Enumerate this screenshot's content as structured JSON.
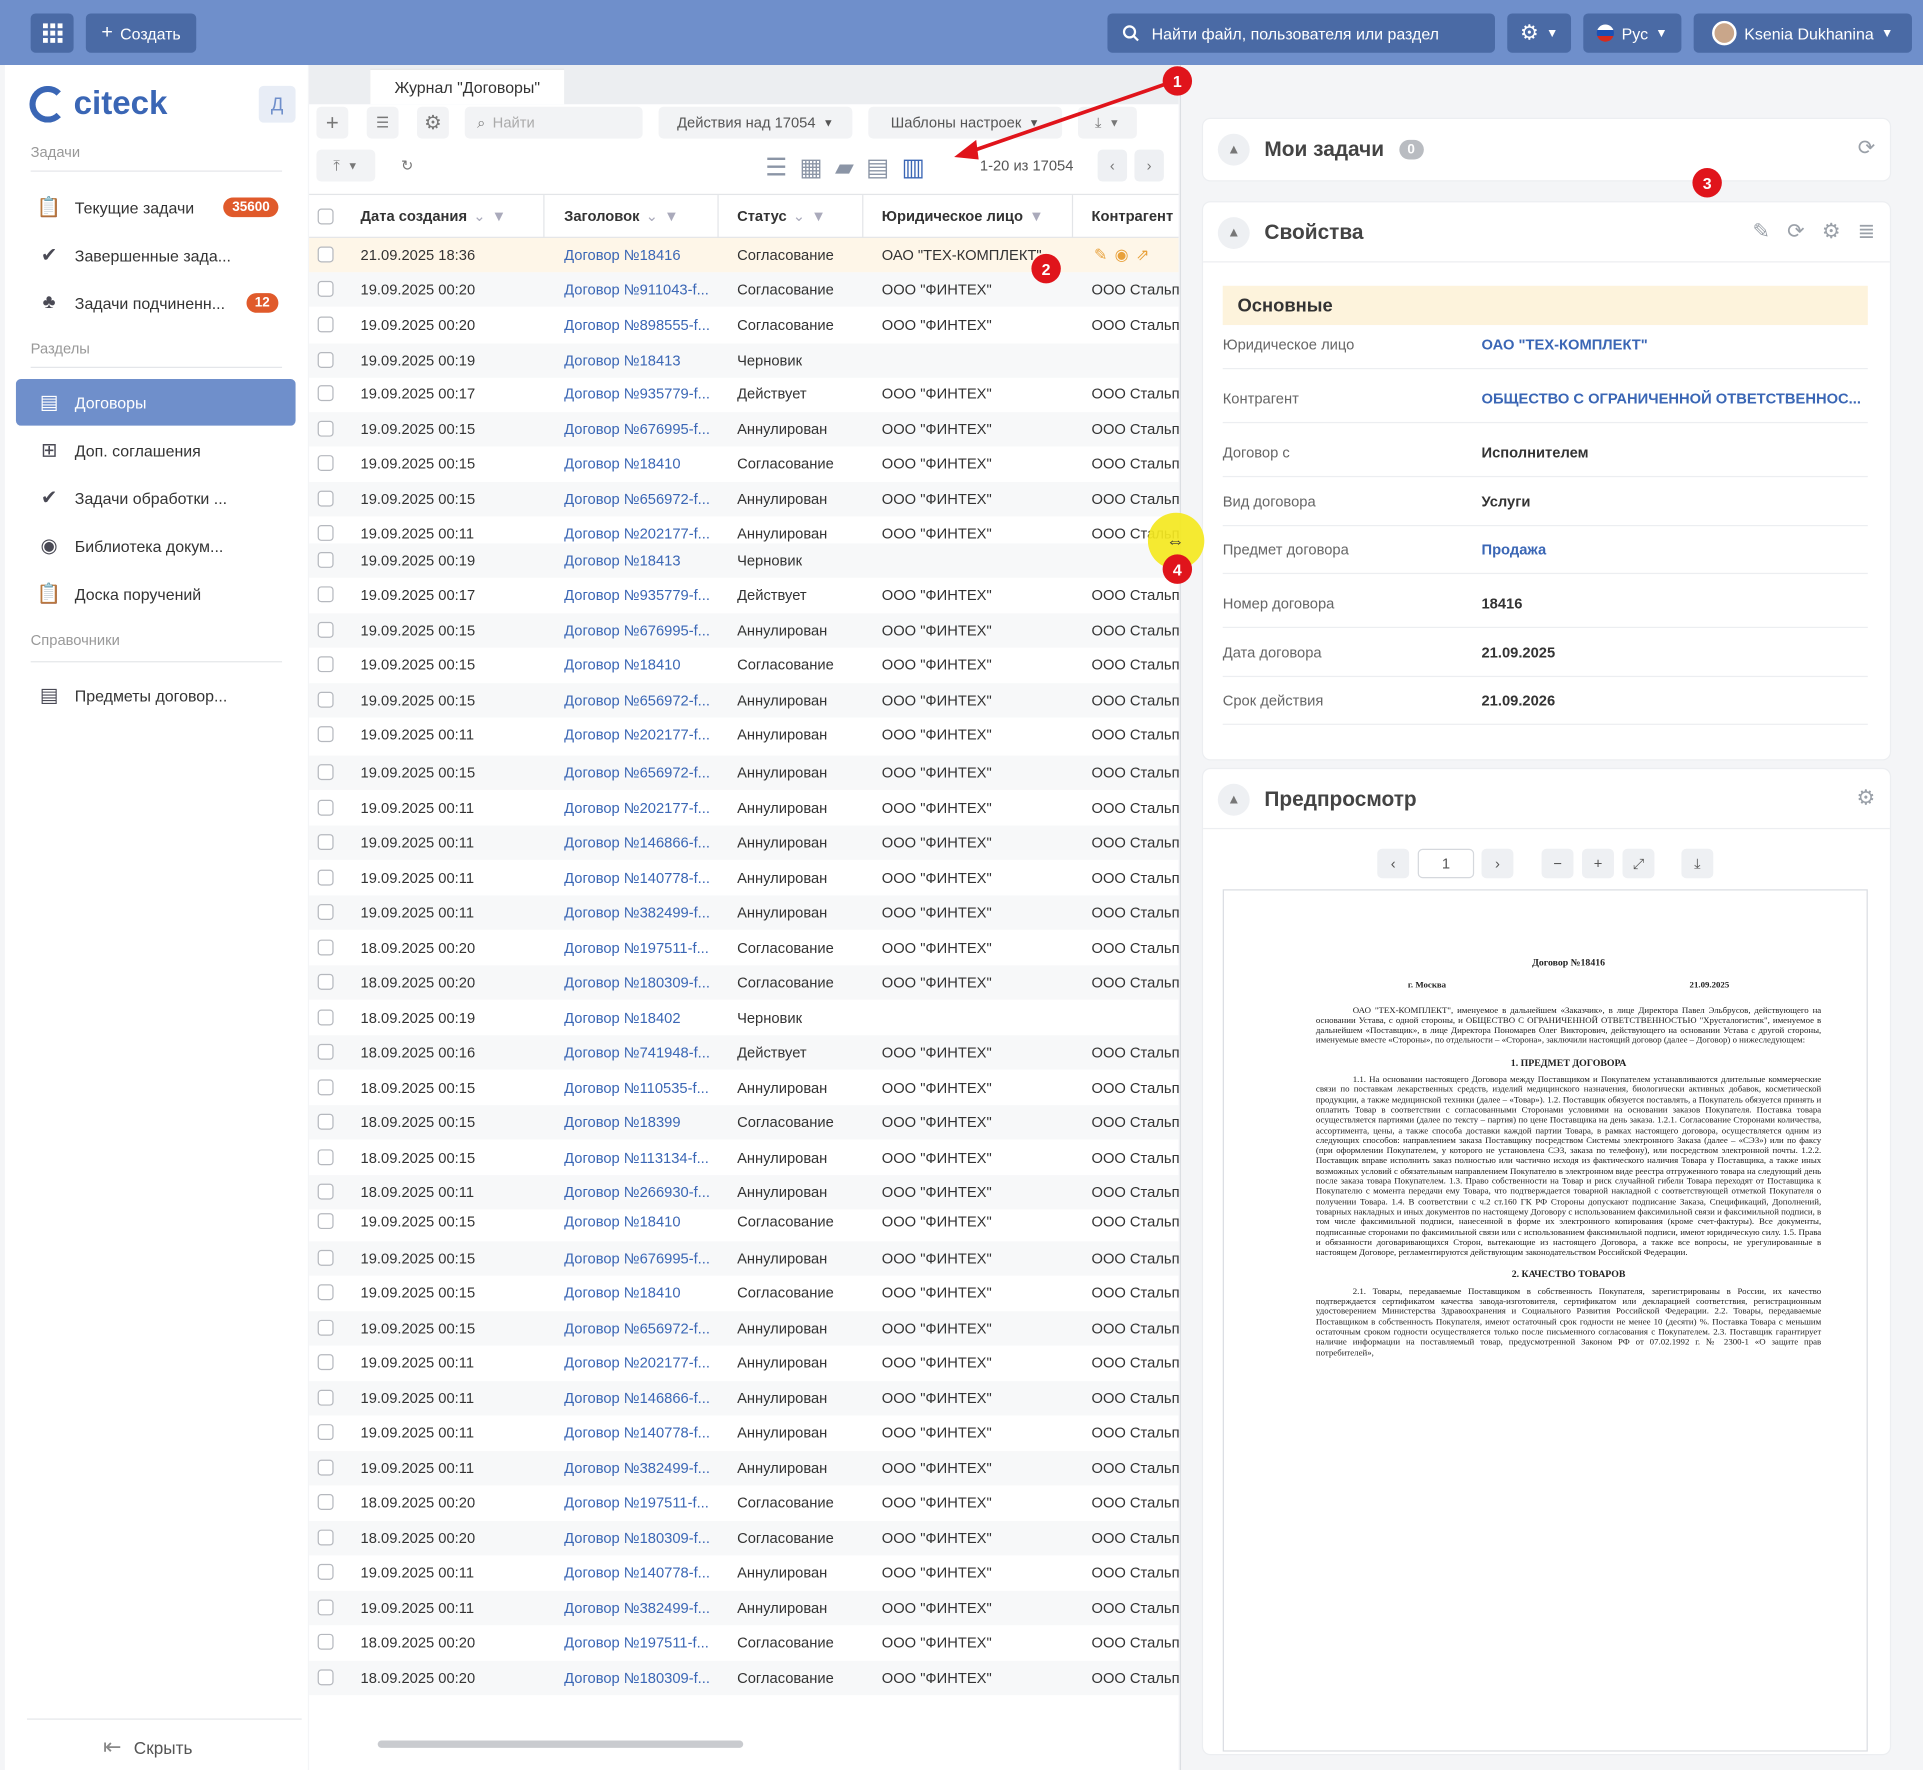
{
  "topbar": {
    "create_label": "Создать",
    "search_placeholder": "Найти файл, пользователя или раздел",
    "lang_label": "Рус",
    "user_name": "Ksenia Dukhanina"
  },
  "sidebar": {
    "logo_text": "citeck",
    "toggle_letter": "Д",
    "section_tasks": "Задачи",
    "section_sections": "Разделы",
    "section_refs": "Справочники",
    "items": [
      {
        "label": "Текущие задачи",
        "badge": "35600"
      },
      {
        "label": "Завершенные зада...",
        "badge": ""
      },
      {
        "label": "Задачи подчиненн...",
        "badge": "12"
      },
      {
        "label": "Договоры",
        "badge": ""
      },
      {
        "label": "Доп. соглашения",
        "badge": ""
      },
      {
        "label": "Задачи обработки ...",
        "badge": ""
      },
      {
        "label": "Библиотека докум...",
        "badge": ""
      },
      {
        "label": "Доска поручений",
        "badge": ""
      },
      {
        "label": "Предметы договор...",
        "badge": ""
      }
    ],
    "hide_label": "Скрыть"
  },
  "journal": {
    "tab_label": "Журнал \"Договоры\"",
    "search_placeholder": "Найти",
    "actions_label": "Действия над 17054",
    "templates_label": "Шаблоны настроек",
    "pagination": "1-20 из 17054",
    "columns": [
      "Дата создания",
      "Заголовок",
      "Статус",
      "Юридическое лицо",
      "Контрагент"
    ],
    "rows": [
      [
        "21.09.2025 18:36",
        "Договор №18416",
        "Согласование",
        "ОАО \"ТЕХ-КОМПЛЕКТ\"",
        ""
      ],
      [
        "19.09.2025 00:20",
        "Договор №911043-f...",
        "Согласование",
        "ООО \"ФИНТЕХ\"",
        "ООО Стальп"
      ],
      [
        "19.09.2025 00:20",
        "Договор №898555-f...",
        "Согласование",
        "ООО \"ФИНТЕХ\"",
        "ООО Стальп"
      ],
      [
        "19.09.2025 00:19",
        "Договор №18413",
        "Черновик",
        "",
        ""
      ],
      [
        "19.09.2025 00:17",
        "Договор №935779-f...",
        "Действует",
        "ООО \"ФИНТЕХ\"",
        "ООО Стальп"
      ],
      [
        "19.09.2025 00:15",
        "Договор №676995-f...",
        "Аннулирован",
        "ООО \"ФИНТЕХ\"",
        "ООО Стальп"
      ],
      [
        "19.09.2025 00:15",
        "Договор №18410",
        "Согласование",
        "ООО \"ФИНТЕХ\"",
        "ООО Стальп"
      ],
      [
        "19.09.2025 00:15",
        "Договор №656972-f...",
        "Аннулирован",
        "ООО \"ФИНТЕХ\"",
        "ООО Стальп"
      ],
      [
        "19.09.2025 00:11",
        "Договор №202177-f...",
        "Аннулирован",
        "ООО \"ФИНТЕХ\"",
        "ООО Стальп"
      ],
      [
        "19.09.2025 00:19",
        "Договор №18413",
        "Черновик",
        "",
        ""
      ],
      [
        "19.09.2025 00:17",
        "Договор №935779-f...",
        "Действует",
        "ООО \"ФИНТЕХ\"",
        "ООО Стальп"
      ],
      [
        "19.09.2025 00:15",
        "Договор №676995-f...",
        "Аннулирован",
        "ООО \"ФИНТЕХ\"",
        "ООО Стальп"
      ],
      [
        "19.09.2025 00:15",
        "Договор №18410",
        "Согласование",
        "ООО \"ФИНТЕХ\"",
        "ООО Стальп"
      ],
      [
        "19.09.2025 00:15",
        "Договор №656972-f...",
        "Аннулирован",
        "ООО \"ФИНТЕХ\"",
        "ООО Стальп"
      ],
      [
        "19.09.2025 00:11",
        "Договор №202177-f...",
        "Аннулирован",
        "ООО \"ФИНТЕХ\"",
        "ООО Стальп"
      ],
      [
        "19.09.2025 00:15",
        "Договор №656972-f...",
        "Аннулирован",
        "ООО \"ФИНТЕХ\"",
        "ООО Стальп"
      ],
      [
        "19.09.2025 00:11",
        "Договор №202177-f...",
        "Аннулирован",
        "ООО \"ФИНТЕХ\"",
        "ООО Стальп"
      ],
      [
        "19.09.2025 00:11",
        "Договор №146866-f...",
        "Аннулирован",
        "ООО \"ФИНТЕХ\"",
        "ООО Стальп"
      ],
      [
        "19.09.2025 00:11",
        "Договор №140778-f...",
        "Аннулирован",
        "ООО \"ФИНТЕХ\"",
        "ООО Стальп"
      ],
      [
        "19.09.2025 00:11",
        "Договор №382499-f...",
        "Аннулирован",
        "ООО \"ФИНТЕХ\"",
        "ООО Стальп"
      ],
      [
        "18.09.2025 00:20",
        "Договор №197511-f...",
        "Согласование",
        "ООО \"ФИНТЕХ\"",
        "ООО Стальп"
      ],
      [
        "18.09.2025 00:20",
        "Договор №180309-f...",
        "Согласование",
        "ООО \"ФИНТЕХ\"",
        "ООО Стальп"
      ],
      [
        "18.09.2025 00:19",
        "Договор №18402",
        "Черновик",
        "",
        ""
      ],
      [
        "18.09.2025 00:16",
        "Договор №741948-f...",
        "Действует",
        "ООО \"ФИНТЕХ\"",
        "ООО Стальп"
      ],
      [
        "18.09.2025 00:15",
        "Договор №110535-f...",
        "Аннулирован",
        "ООО \"ФИНТЕХ\"",
        "ООО Стальп"
      ],
      [
        "18.09.2025 00:15",
        "Договор №18399",
        "Согласование",
        "ООО \"ФИНТЕХ\"",
        "ООО Стальп"
      ],
      [
        "18.09.2025 00:15",
        "Договор №113134-f...",
        "Аннулирован",
        "ООО \"ФИНТЕХ\"",
        "ООО Стальп"
      ],
      [
        "18.09.2025 00:11",
        "Договор №266930-f...",
        "Аннулирован",
        "ООО \"ФИНТЕХ\"",
        "ООО Стальп"
      ],
      [
        "19.09.2025 00:15",
        "Договор №18410",
        "Согласование",
        "ООО \"ФИНТЕХ\"",
        "ООО Стальп"
      ],
      [
        "19.09.2025 00:15",
        "Договор №676995-f...",
        "Аннулирован",
        "ООО \"ФИНТЕХ\"",
        "ООО Стальп"
      ],
      [
        "19.09.2025 00:15",
        "Договор №18410",
        "Согласование",
        "ООО \"ФИНТЕХ\"",
        "ООО Стальп"
      ],
      [
        "19.09.2025 00:15",
        "Договор №656972-f...",
        "Аннулирован",
        "ООО \"ФИНТЕХ\"",
        "ООО Стальп"
      ],
      [
        "19.09.2025 00:11",
        "Договор №202177-f...",
        "Аннулирован",
        "ООО \"ФИНТЕХ\"",
        "ООО Стальп"
      ],
      [
        "19.09.2025 00:11",
        "Договор №146866-f...",
        "Аннулирован",
        "ООО \"ФИНТЕХ\"",
        "ООО Стальп"
      ],
      [
        "19.09.2025 00:11",
        "Договор №140778-f...",
        "Аннулирован",
        "ООО \"ФИНТЕХ\"",
        "ООО Стальп"
      ],
      [
        "19.09.2025 00:11",
        "Договор №382499-f...",
        "Аннулирован",
        "ООО \"ФИНТЕХ\"",
        "ООО Стальп"
      ],
      [
        "18.09.2025 00:20",
        "Договор №197511-f...",
        "Согласование",
        "ООО \"ФИНТЕХ\"",
        "ООО Стальп"
      ],
      [
        "18.09.2025 00:20",
        "Договор №180309-f...",
        "Согласование",
        "ООО \"ФИНТЕХ\"",
        "ООО Стальп"
      ],
      [
        "19.09.2025 00:11",
        "Договор №140778-f...",
        "Аннулирован",
        "ООО \"ФИНТЕХ\"",
        "ООО Стальп"
      ],
      [
        "19.09.2025 00:11",
        "Договор №382499-f...",
        "Аннулирован",
        "ООО \"ФИНТЕХ\"",
        "ООО Стальп"
      ],
      [
        "18.09.2025 00:20",
        "Договор №197511-f...",
        "Согласование",
        "ООО \"ФИНТЕХ\"",
        "ООО Стальп"
      ],
      [
        "18.09.2025 00:20",
        "Договор №180309-f...",
        "Согласование",
        "ООО \"ФИНТЕХ\"",
        "ООО Стальп"
      ]
    ]
  },
  "tasks_card": {
    "title": "Мои задачи",
    "count": "0"
  },
  "props_card": {
    "title": "Свойства",
    "section": "Основные",
    "fields": [
      {
        "k": "Юридическое лицо",
        "v": "ОАО \"ТЕХ-КОМПЛЕКТ\""
      },
      {
        "k": "Контрагент",
        "v": "ОБЩЕСТВО С ОГРАНИЧЕННОЙ ОТВЕТСТВЕННОС..."
      },
      {
        "k": "Договор с",
        "v": "Исполнителем"
      },
      {
        "k": "Вид договора",
        "v": "Услуги"
      },
      {
        "k": "Предмет договора",
        "v": "Продажа"
      },
      {
        "k": "Номер договора",
        "v": "18416"
      },
      {
        "k": "Дата договора",
        "v": "21.09.2025"
      },
      {
        "k": "Срок действия",
        "v": "21.09.2026"
      }
    ]
  },
  "preview_card": {
    "title": "Предпросмотр",
    "page": "1",
    "doc_title": "Договор №18416",
    "doc_city": "г. Москва",
    "doc_date": "21.09.2025",
    "doc_intro": "ОАО \"ТЕХ-КОМПЛЕКТ\", именуемое в дальнейшем «Заказчик», в лице Директора Павел Эльбрусов, действующего на основании Устава, с одной стороны, и ОБЩЕСТВО С ОГРАНИЧЕННОЙ ОТВЕТСТВЕННОСТЬЮ \"Хрусталогистик\", именуемое в дальнейшем «Поставщик», в лице Директора Пономарев Олег Викторович, действующего на основании Устава с другой стороны, именуемые вместе «Стороны», по отдельности – «Сторона», заключили настоящий договор (далее – Договор) о нижеследующем:",
    "doc_h1": "1. ПРЕДМЕТ ДОГОВОРА",
    "doc_p1": "1.1. На основании настоящего Договора между Поставщиком и Покупателем устанавливаются длительные коммерческие связи по поставкам лекарственных средств, изделий медицинского назначения, биологически активных добавок, косметической продукции, а также медицинской техники (далее – «Товар»). 1.2. Поставщик обязуется поставлять, а Покупатель обязуется принять и оплатить Товар в соответствии с согласованными Сторонами условиями на основании заказов Покупателя. Поставка товара осуществляется партиями (далее по тексту – партия) по цене Поставщика на день заказа. 1.2.1. Согласование Сторонами количества, ассортимента, цены, а также способа доставки каждой партии Товара, в рамках настоящего договора, осуществляется одним из следующих способов: направлением заказа Поставщику посредством Системы электронного Заказа (далее – «СЭЗ») или по факсу (при оформлении Покупателем, у которого не установлена СЭЗ, заказа по телефону), или посредством электронной почты. 1.2.2. Поставщик вправе исполнить заказ полностью или частично исходя из фактического наличия Товара у Поставщика, а также иных возможных условий с обязательным направлением Покупателю в электронном виде реестра отгруженного товара на следующий день после заказа товара Покупателем. 1.3. Право собственности на Товар и риск случайной гибели Товара переходят от Поставщика к Покупателю с момента передачи ему Товара, что подтверждается товарной накладной с соответствующей отметкой Покупателя о получении Товара. 1.4. В соответствии с ч.2 ст.160 ГК РФ Стороны допускают подписание Заказа, Спецификаций, Дополнений, товарных накладных и иных документов по настоящему Договору с использованием факсимильной связи и факсимильной подписи, в том числе факсимильной подписи, нанесенной в форме их электронного копирования (кроме счет-фактуры). Все документы, подписанные сторонами по факсимильной связи или с использованием факсимильной подписи, имеют юридическую силу. 1.5. Права и обязанности договаривающихся Сторон, вытекающие из настоящего Договора, а также все вопросы, не урегулированные в настоящем Договоре, регламентируются действующим законодательством Российской Федерации.",
    "doc_h2": "2. КАЧЕСТВО ТОВАРОВ",
    "doc_p2": "2.1. Товары, передаваемые Поставщиком в собственность Покупателя, зарегистрированы в России, их качество подтверждается сертификатом качества завода-изготовителя, сертификатом или декларацией соответствия, регистрационным удостоверением Министерства Здравоохранения и Социального Развития Российской Федерации. 2.2. Товары, передаваемые Поставщиком в собственность Покупателя, имеют остаточный срок годности не менее 10 (десяти) %. Поставка Товара с меньшим остаточным сроком годности осуществляется только после письменного согласования с Покупателем. 2.3. Поставщик гарантирует наличие информации на поставляемый товар, предусмотренной Законом РФ от 07.02.1992 г. № 2300-1 «О защите прав потребителей»,"
  },
  "annotations": [
    "1",
    "2",
    "3",
    "4"
  ],
  "colors": {
    "topbar": "#6f8fcb",
    "accent": "#3a66b5",
    "badge": "#e05a2b",
    "marker": "#e0141b",
    "highlight": "#f4e81f"
  }
}
